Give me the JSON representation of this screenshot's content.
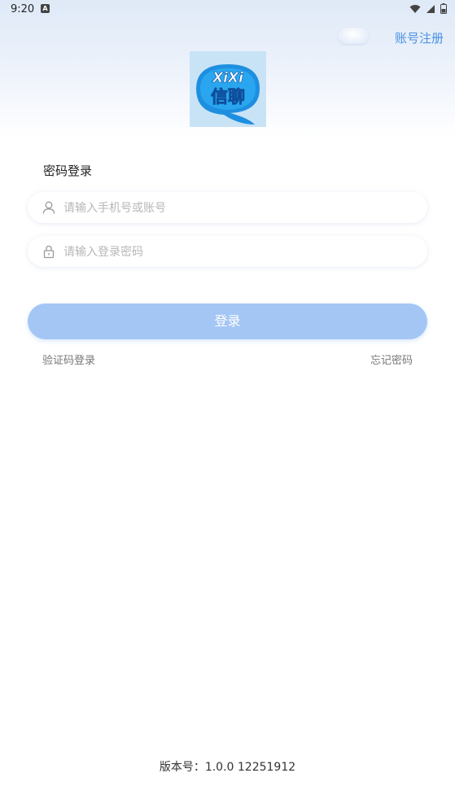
{
  "status_bar": {
    "time": "9:20",
    "notification_icon": "a-letter-icon",
    "icons": [
      "wifi-icon",
      "signal-icon",
      "battery-icon"
    ]
  },
  "header": {
    "register_label": "账号注册"
  },
  "logo": {
    "line1": "XiXi",
    "line2": "信聊"
  },
  "form": {
    "title": "密码登录",
    "account": {
      "placeholder": "请输入手机号或账号",
      "value": ""
    },
    "password": {
      "placeholder": "请输入登录密码",
      "value": ""
    },
    "login_label": "登录",
    "sms_login_label": "验证码登录",
    "forgot_label": "忘记密码"
  },
  "footer": {
    "version_label": "版本号：",
    "version": "1.0.0 12251912"
  },
  "colors": {
    "accent": "#4a90e2",
    "button": "#a3c6f5",
    "logo_bg": "#c9e3f6"
  }
}
